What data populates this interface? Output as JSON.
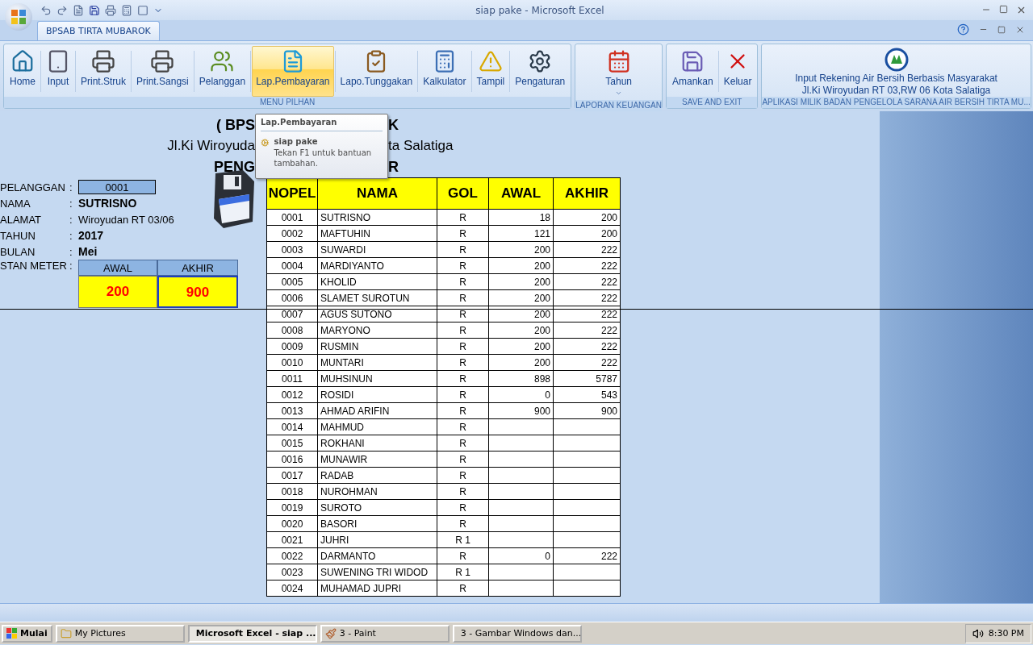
{
  "window": {
    "title": "siap pake - Microsoft Excel"
  },
  "tabs": [
    {
      "label": "BPSAB TIRTA MUBAROK",
      "selected": true
    }
  ],
  "ribbon": {
    "groups": [
      {
        "label": "MENU PILHAN",
        "buttons": [
          {
            "label": "Home",
            "kind": "home",
            "selected": false
          },
          {
            "label": "Input",
            "kind": "tablet",
            "selected": false
          },
          {
            "label": "Print.Struk",
            "kind": "printer",
            "selected": false
          },
          {
            "label": "Print.Sangsi",
            "kind": "printer",
            "selected": false
          },
          {
            "label": "Pelanggan",
            "kind": "people",
            "selected": false
          },
          {
            "label": "Lap.Pembayaran",
            "kind": "document",
            "selected": true
          },
          {
            "label": "Lapo.Tunggakan",
            "kind": "clipboard",
            "selected": false
          },
          {
            "label": "Kalkulator",
            "kind": "calculator",
            "selected": false
          },
          {
            "label": "Tampil",
            "kind": "warning",
            "selected": false
          },
          {
            "label": "Pengaturan",
            "kind": "gear",
            "selected": false
          }
        ]
      },
      {
        "label": "LAPORAN KEUANGAN",
        "buttons": [
          {
            "label": "Tahun",
            "kind": "calendar",
            "selected": false,
            "dropdown": true
          }
        ]
      },
      {
        "label": "SAVE AND EXIT",
        "buttons": [
          {
            "label": "Amankan",
            "kind": "save",
            "selected": false
          },
          {
            "label": "Keluar",
            "kind": "close",
            "selected": false
          }
        ]
      },
      {
        "label": "APLIKASI MILIK BADAN PENGELOLA SARANA AIR BERSIH TIRTA MU...",
        "info": [
          "Input Rekening Air Bersih Berbasis Masyarakat",
          "Jl.Ki Wiroyudan RT 03,RW 06 Kota Salatiga"
        ]
      }
    ]
  },
  "tooltip": {
    "title": "Lap.Pembayaran",
    "item": "siap pake",
    "hint": "Tekan F1 untuk bantuan tambahan."
  },
  "sheet": {
    "heading": [
      {
        "left": "( BPS",
        "right": "K"
      },
      {
        "left": "Jl.Ki Wiroyuda",
        "right": "ta Salatiga"
      },
      {
        "left": "PENG",
        "right": "R"
      }
    ],
    "form": [
      {
        "label": "PELANGGAN",
        "colon": ":",
        "value": "0001",
        "kind": "box"
      },
      {
        "label": "NAMA",
        "colon": ":",
        "value": "SUTRISNO",
        "kind": "bold"
      },
      {
        "label": "ALAMAT",
        "colon": ":",
        "value": "Wiroyudan RT 03/06",
        "kind": "plain"
      },
      {
        "label": "TAHUN",
        "colon": ":",
        "value": "2017",
        "kind": "bold"
      },
      {
        "label": "BULAN",
        "colon": ":",
        "value": "Mei",
        "kind": "bold"
      }
    ],
    "meter": {
      "label": "STAN METER",
      "colon": ":",
      "columns": [
        "AWAL",
        "AKHIR"
      ],
      "values": [
        "200",
        "900"
      ]
    },
    "table": {
      "columns": [
        "NOPEL",
        "NAMA",
        "GOL",
        "AWAL",
        "AKHIR"
      ],
      "rows": [
        [
          "0001",
          "SUTRISNO",
          "R",
          "18",
          "200"
        ],
        [
          "0002",
          "MAFTUHIN",
          "R",
          "121",
          "200"
        ],
        [
          "0003",
          "SUWARDI",
          "R",
          "200",
          "222"
        ],
        [
          "0004",
          "MARDIYANTO",
          "R",
          "200",
          "222"
        ],
        [
          "0005",
          "KHOLID",
          "R",
          "200",
          "222"
        ],
        [
          "0006",
          "SLAMET SUROTUN",
          "R",
          "200",
          "222"
        ],
        [
          "0007",
          "AGUS SUTONO",
          "R",
          "200",
          "222"
        ],
        [
          "0008",
          "MARYONO",
          "R",
          "200",
          "222"
        ],
        [
          "0009",
          "RUSMIN",
          "R",
          "200",
          "222"
        ],
        [
          "0010",
          "MUNTARI",
          "R",
          "200",
          "222"
        ],
        [
          "0011",
          "MUHSINUN",
          "R",
          "898",
          "5787"
        ],
        [
          "0012",
          "ROSIDI",
          "R",
          "0",
          "543"
        ],
        [
          "0013",
          "AHMAD ARIFIN",
          "R",
          "900",
          "900"
        ],
        [
          "0014",
          "MAHMUD",
          "R",
          "",
          ""
        ],
        [
          "0015",
          "ROKHANI",
          "R",
          "",
          ""
        ],
        [
          "0016",
          "MUNAWIR",
          "R",
          "",
          ""
        ],
        [
          "0017",
          "RADAB",
          "R",
          "",
          ""
        ],
        [
          "0018",
          "NUROHMAN",
          "R",
          "",
          ""
        ],
        [
          "0019",
          "SUROTO",
          "R",
          "",
          ""
        ],
        [
          "0020",
          "BASORI",
          "R",
          "",
          ""
        ],
        [
          "0021",
          "JUHRI",
          "R 1",
          "",
          ""
        ],
        [
          "0022",
          "DARMANTO",
          "R",
          "0",
          "222"
        ],
        [
          "0023",
          "SUWENING TRI WIDOD",
          "R 1",
          "",
          ""
        ],
        [
          "0024",
          "MUHAMAD JUPRI",
          "R",
          "",
          ""
        ]
      ]
    }
  },
  "taskbar": {
    "start": "Mulai",
    "items": [
      {
        "label": "My Pictures",
        "kind": "folder",
        "selected": false
      },
      {
        "label": "Microsoft Excel - siap ...",
        "kind": "excel",
        "selected": true
      },
      {
        "label": "3 - Paint",
        "kind": "paint",
        "selected": false
      },
      {
        "label": "3 - Gambar Windows dan...",
        "kind": "image",
        "selected": false
      }
    ],
    "clock": "8:30 PM"
  }
}
